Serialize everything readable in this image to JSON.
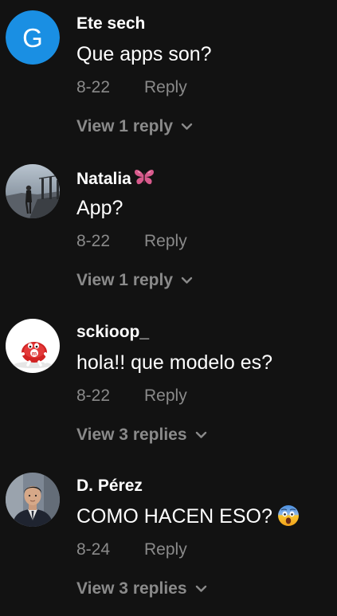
{
  "comments": [
    {
      "username": "Ete sech",
      "avatar_letter": "G",
      "avatar_color": "#1a8fe3",
      "text": "Que apps son?",
      "date": "8-22",
      "reply_label": "Reply",
      "view_replies_label": "View 1 reply"
    },
    {
      "username": "Natalia",
      "badge_icon": "butterfly-icon",
      "text": "App?",
      "date": "8-22",
      "reply_label": "Reply",
      "view_replies_label": "View 1 reply"
    },
    {
      "username": "sckioop_",
      "text": "hola!! que modelo es?",
      "date": "8-22",
      "reply_label": "Reply",
      "view_replies_label": "View 3 replies"
    },
    {
      "username": "D. Pérez",
      "text": "COMO HACEN ESO?",
      "text_emoji_icon": "screaming-face-icon",
      "date": "8-24",
      "reply_label": "Reply",
      "view_replies_label": "View 3 replies"
    }
  ],
  "colors": {
    "background": "#121212",
    "primary_text": "#ffffff",
    "secondary_text": "#8a8a8a"
  }
}
